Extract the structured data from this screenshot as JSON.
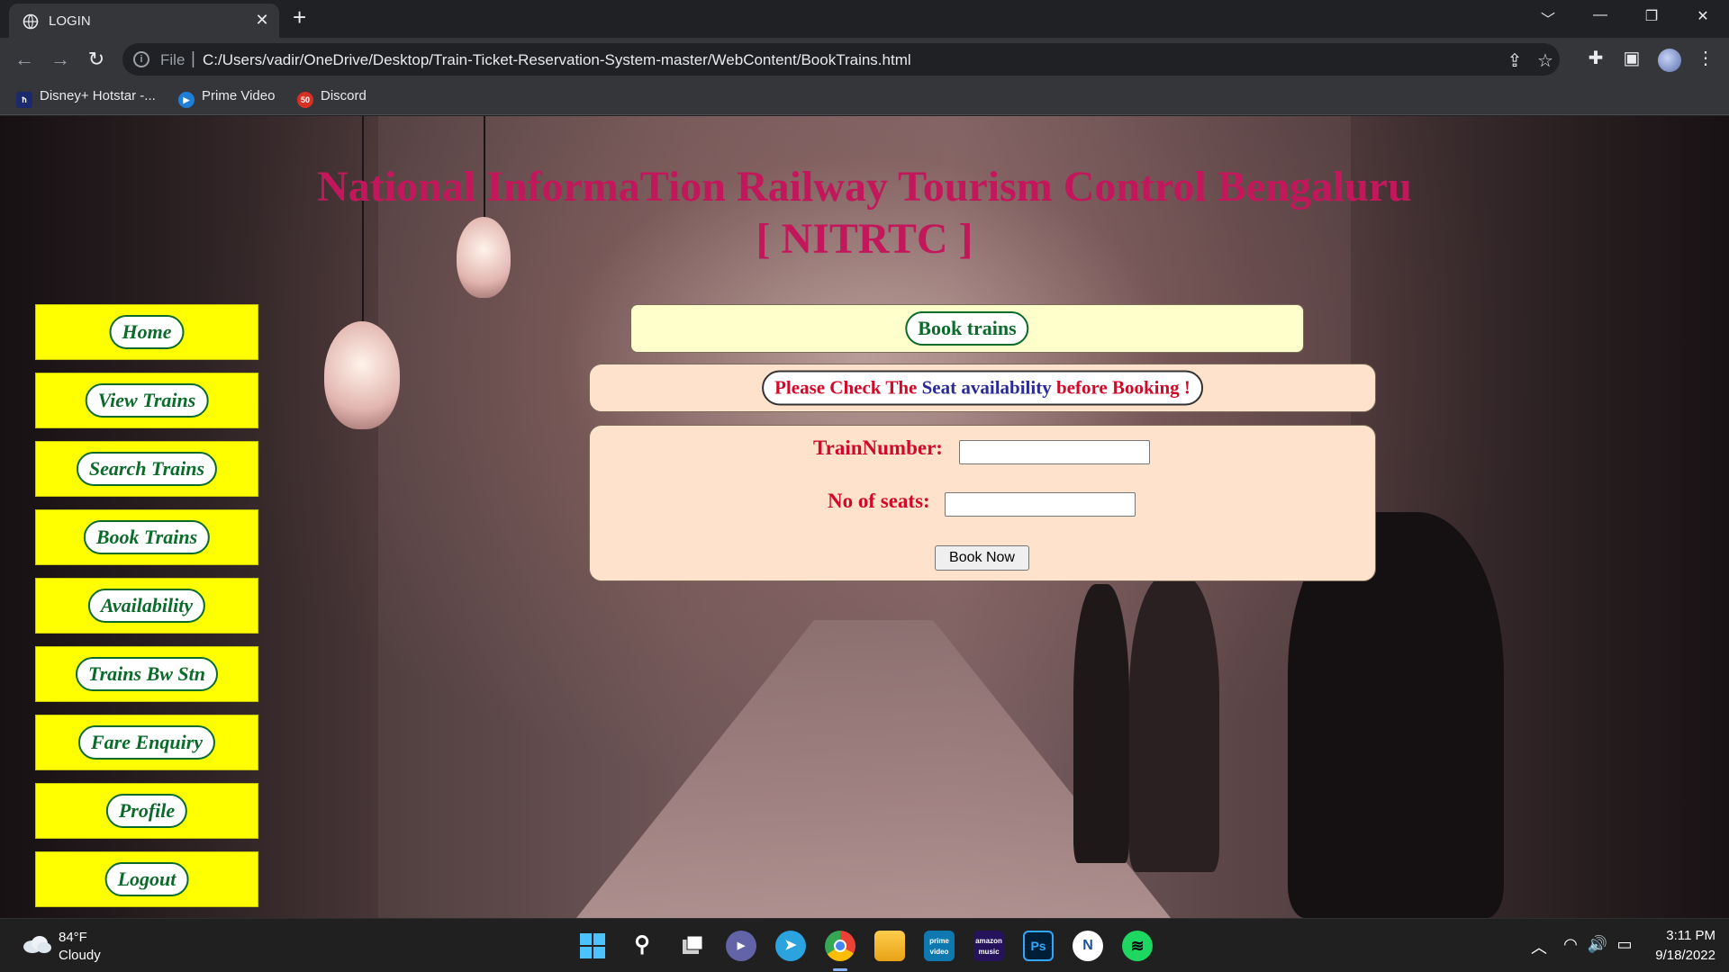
{
  "browser": {
    "tab_title": "LOGIN",
    "tab_close": "✕",
    "new_tab": "+",
    "window_controls": [
      "﹀",
      "—",
      "❐",
      "✕"
    ],
    "url_scheme": "File",
    "url": "C:/Users/vadir/OneDrive/Desktop/Train-Ticket-Reservation-System-master/WebContent/BookTrains.html",
    "bookmarks": [
      {
        "label": "Disney+ Hotstar -...",
        "icon": "hotstar-icon"
      },
      {
        "label": "Prime Video",
        "icon": "prime-video-icon"
      },
      {
        "label": "Discord",
        "icon": "discord-icon"
      }
    ]
  },
  "page": {
    "title_line1": "National InformaTion Railway Tourism Control Bengaluru",
    "title_line2": "[ NITRTC ]",
    "sidebar": [
      {
        "label": "Home"
      },
      {
        "label": "View Trains"
      },
      {
        "label": "Search Trains"
      },
      {
        "label": "Book Trains"
      },
      {
        "label": "Availability"
      },
      {
        "label": "Trains Bw Stn"
      },
      {
        "label": "Fare Enquiry"
      },
      {
        "label": "Profile"
      },
      {
        "label": "Logout"
      }
    ],
    "header_label": "Book trains",
    "notice": {
      "part1": "Please Check The ",
      "part2": "Seat availability",
      "part3": " before Booking !"
    },
    "form": {
      "train_number_label": "TrainNumber:",
      "train_number_value": "",
      "seats_label": "No of seats:",
      "seats_value": "",
      "submit_label": "Book Now"
    },
    "colors": {
      "title": "#c2185b",
      "sidebar_button": "#ffff00",
      "pill_text": "#0b6b2a",
      "form_label": "#d10a2a"
    }
  },
  "taskbar": {
    "weather_temp": "84°F",
    "weather_condition": "Cloudy",
    "time": "3:11 PM",
    "date": "9/18/2022",
    "apps": [
      {
        "name": "start-icon",
        "label": ""
      },
      {
        "name": "search-icon",
        "label": ""
      },
      {
        "name": "task-view-icon",
        "label": ""
      },
      {
        "name": "teams-chat-icon",
        "label": ""
      },
      {
        "name": "telegram-icon",
        "label": ""
      },
      {
        "name": "chrome-icon",
        "label": ""
      },
      {
        "name": "file-explorer-icon",
        "label": ""
      },
      {
        "name": "prime-video-app-icon",
        "label": "prime video"
      },
      {
        "name": "amazon-music-icon",
        "label": "amazon music"
      },
      {
        "name": "photoshop-icon",
        "label": "Ps"
      },
      {
        "name": "app-n-icon",
        "label": "N"
      },
      {
        "name": "spotify-icon",
        "label": ""
      }
    ]
  }
}
